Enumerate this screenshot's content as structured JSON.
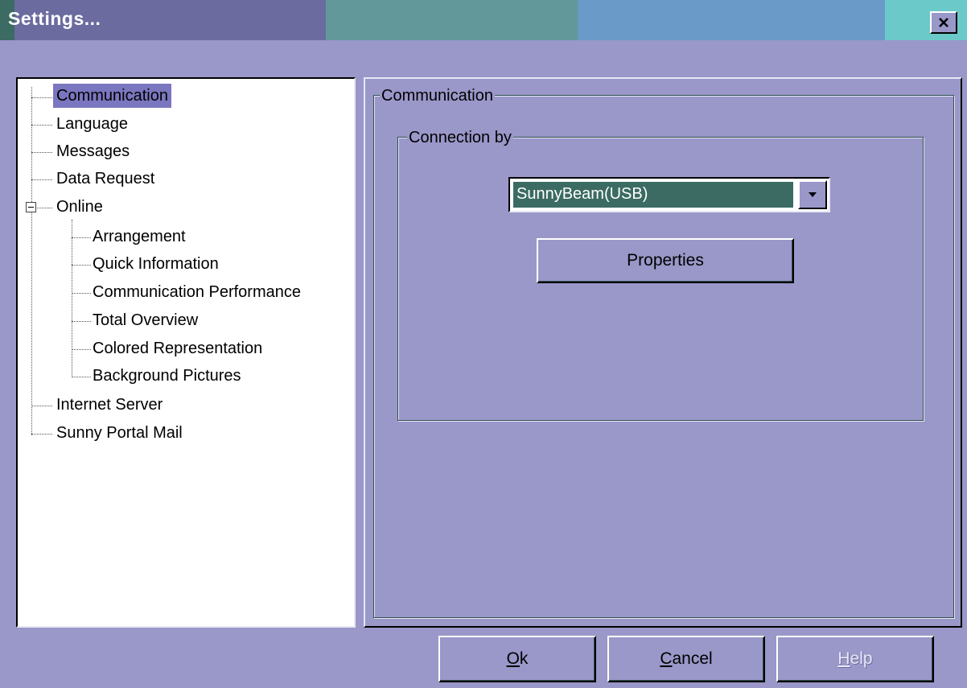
{
  "window": {
    "title": "Settings..."
  },
  "tree": {
    "items": [
      {
        "label": "Communication"
      },
      {
        "label": "Language"
      },
      {
        "label": "Messages"
      },
      {
        "label": "Data Request"
      },
      {
        "label": "Online"
      },
      {
        "label": "Arrangement"
      },
      {
        "label": "Quick Information"
      },
      {
        "label": "Communication Performance"
      },
      {
        "label": "Total Overview"
      },
      {
        "label": "Colored Representation"
      },
      {
        "label": "Background Pictures"
      },
      {
        "label": "Internet Server"
      },
      {
        "label": "Sunny Portal Mail"
      }
    ],
    "selected": "Communication",
    "expanded": "Online"
  },
  "panel": {
    "group_label": "Communication",
    "connection_group_label": "Connection by",
    "connection_value": "SunnyBeam(USB)",
    "properties_label": "Properties"
  },
  "buttons": {
    "ok": {
      "mnemonic": "O",
      "rest": "k"
    },
    "cancel": {
      "mnemonic": "C",
      "rest": "ancel"
    },
    "help": {
      "mnemonic": "H",
      "rest": "elp"
    }
  },
  "colors": {
    "dialog_bg": "#9a97c9",
    "selection": "#3b6b62",
    "tree_selection": "#7a76c0"
  },
  "icons": {
    "close": "close-icon",
    "dropdown": "chevron-down-icon",
    "collapse": "minus-box-icon"
  }
}
